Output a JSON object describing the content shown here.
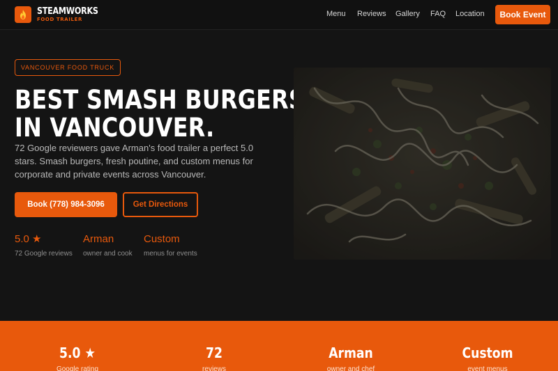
{
  "nav": {
    "brand_name": "STEAMWORKS",
    "brand_sub": "FOOD TRAILER",
    "logo_icon": "flame-icon",
    "links": [
      "Menu",
      "Reviews",
      "Gallery",
      "FAQ",
      "Location"
    ],
    "cta": "Book Event"
  },
  "hero": {
    "tag": "VANCOUVER FOOD TRUCK",
    "headline_line1": "BEST SMASH BURGERS",
    "headline_line2": "IN VANCOUVER.",
    "lede": "72 Google reviewers gave Arman's food trailer a perfect 5.0 stars. Smash burgers, fresh poutine, and custom menus for corporate and private events across Vancouver.",
    "primary_button": "Book (778) 984-3096",
    "secondary_button": "Get Directions",
    "stats": [
      {
        "value": "5.0 ★",
        "label": "72 Google reviews"
      },
      {
        "value": "Arman",
        "label": "owner and cook"
      },
      {
        "value": "Custom",
        "label": "menus for events"
      }
    ]
  },
  "band": {
    "items": [
      {
        "value": "5.0 ★",
        "label": "Google rating"
      },
      {
        "value": "72",
        "label": "reviews"
      },
      {
        "value": "Arman",
        "label": "owner and chef"
      },
      {
        "value": "Custom",
        "label": "event menus"
      }
    ]
  },
  "colors": {
    "accent": "#e8590c",
    "background": "#141414",
    "nav_background": "#111111"
  }
}
